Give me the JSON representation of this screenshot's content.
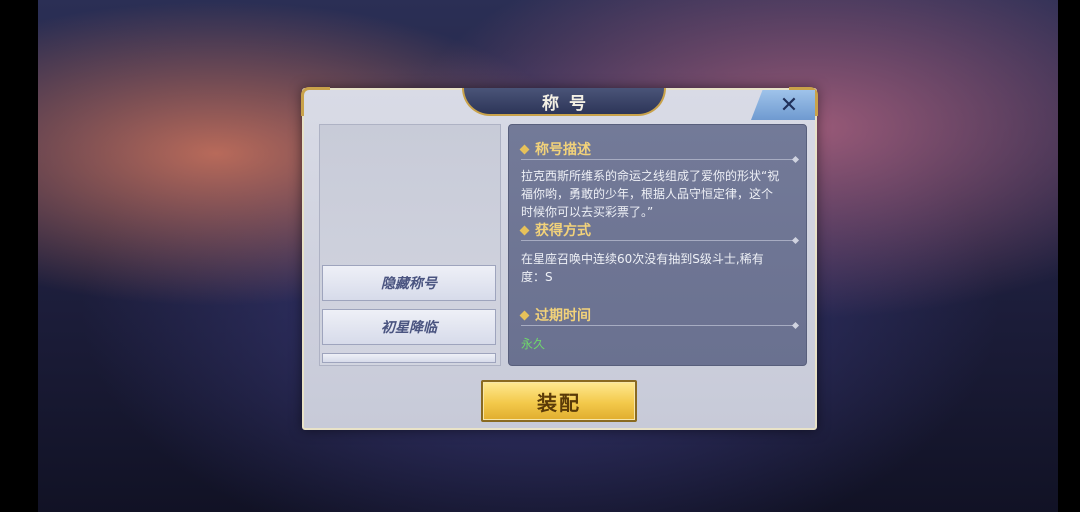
{
  "dialog": {
    "title": "称号",
    "close_icon": "close-icon"
  },
  "title_list": [
    "隐藏称号",
    "初星降临"
  ],
  "sections": [
    {
      "title": "称号描述",
      "text": "拉克西斯所维系的命运之线组成了爱你的形状“祝福你哟，勇敢的少年，根据人品守恒定律，这个时候你可以去买彩票了。”"
    },
    {
      "title": "获得方式",
      "text": "在星座召唤中连续60次没有抽到S级斗士,稀有度：S"
    },
    {
      "title": "过期时间",
      "text": "永久"
    }
  ],
  "buttons": {
    "equip": "装配"
  },
  "colors": {
    "gold": "#f2d27a",
    "green": "#6fd86a",
    "button_gold": "#f3c94b"
  }
}
